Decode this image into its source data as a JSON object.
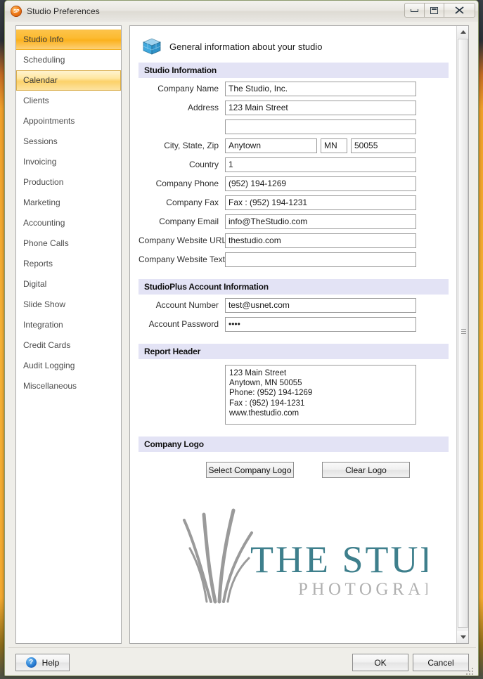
{
  "window": {
    "title": "Studio Preferences",
    "app_icon": "studio-plus-logo-icon",
    "minimize_label": "Minimize",
    "restore_label": "Restore",
    "close_label": "Close"
  },
  "sidebar": {
    "items": [
      {
        "label": "Studio Info",
        "state": "selected"
      },
      {
        "label": "Scheduling",
        "state": "normal"
      },
      {
        "label": "Calendar",
        "state": "hover"
      },
      {
        "label": "Clients",
        "state": "normal"
      },
      {
        "label": "Appointments",
        "state": "normal"
      },
      {
        "label": "Sessions",
        "state": "normal"
      },
      {
        "label": "Invoicing",
        "state": "normal"
      },
      {
        "label": "Production",
        "state": "normal"
      },
      {
        "label": "Marketing",
        "state": "normal"
      },
      {
        "label": "Accounting",
        "state": "normal"
      },
      {
        "label": "Phone Calls",
        "state": "normal"
      },
      {
        "label": "Reports",
        "state": "normal"
      },
      {
        "label": "Digital",
        "state": "normal"
      },
      {
        "label": "Slide Show",
        "state": "normal"
      },
      {
        "label": "Integration",
        "state": "normal"
      },
      {
        "label": "Credit Cards",
        "state": "normal"
      },
      {
        "label": "Audit Logging",
        "state": "normal"
      },
      {
        "label": "Miscellaneous",
        "state": "normal"
      }
    ]
  },
  "content": {
    "header_title": "General information about your studio",
    "header_icon": "blue-cube-icon",
    "sections": {
      "studio_information": "Studio Information",
      "studioplus_account": "StudioPlus Account Information",
      "report_header": "Report Header",
      "company_logo": "Company Logo"
    },
    "fields": {
      "company_name": {
        "label": "Company Name",
        "value": "The Studio, Inc."
      },
      "address1": {
        "label": "Address",
        "value": "123 Main Street"
      },
      "address2": {
        "label": "",
        "value": ""
      },
      "city_state_zip_label": "City, State, Zip",
      "city": {
        "value": "Anytown"
      },
      "state": {
        "value": "MN"
      },
      "zip": {
        "value": "50055"
      },
      "country": {
        "label": "Country",
        "value": "1"
      },
      "company_phone": {
        "label": "Company Phone",
        "value": "(952) 194-1269"
      },
      "company_fax": {
        "label": "Company Fax",
        "value": "Fax  :  (952) 194-1231"
      },
      "company_email": {
        "label": "Company Email",
        "value": "info@TheStudio.com"
      },
      "website_url": {
        "label": "Company Website URL",
        "value": "thestudio.com"
      },
      "website_text": {
        "label": "Company Website Text",
        "value": ""
      },
      "account_number": {
        "label": "Account Number",
        "value": "test@usnet.com"
      },
      "account_password": {
        "label": "Account Password",
        "value": "••••"
      }
    },
    "report_header_text": "123 Main Street\nAnytown, MN 50055\nPhone:  (952) 194-1269\nFax  :  (952) 194-1231\nwww.thestudio.com",
    "logo_buttons": {
      "select": "Select Company Logo",
      "clear": "Clear Logo"
    },
    "logo": {
      "primary_text": "THE STUDIO",
      "secondary_text": "PHOTOGRAPHY",
      "primary_color": "#3e7f8c",
      "secondary_color": "#a8a8a8",
      "grass_color": "#9a9a9a"
    }
  },
  "scrollbar": {
    "up_arrow": "scroll-up-arrow-icon",
    "down_arrow": "scroll-down-arrow-icon"
  },
  "footer": {
    "help": "Help",
    "help_icon": "help-question-icon",
    "ok": "OK",
    "cancel": "Cancel"
  }
}
